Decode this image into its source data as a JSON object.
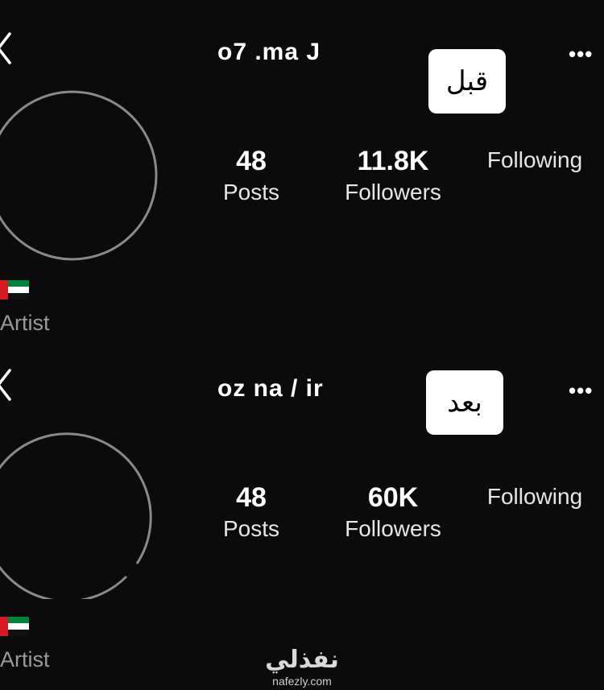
{
  "panels": [
    {
      "username": "o7 .ma J",
      "tag": "قبل",
      "stats": {
        "posts_count": "48",
        "posts_label": "Posts",
        "followers_count": "11.8K",
        "followers_label": "Followers",
        "following_label": "Following"
      },
      "bio": {
        "flag_icon": "uae-flag-icon",
        "category": "Artist"
      }
    },
    {
      "username": "oz na / ir",
      "tag": "بعد",
      "stats": {
        "posts_count": "48",
        "posts_label": "Posts",
        "followers_count": "60K",
        "followers_label": "Followers",
        "following_label": "Following"
      },
      "bio": {
        "flag_icon": "uae-flag-icon",
        "category": "Artist"
      }
    }
  ],
  "more_glyph": "•••",
  "watermark": {
    "logo_text": "نفذلي",
    "url": "nafezly.com"
  },
  "colors": {
    "background": "#0b0b0c",
    "text": "#f2f2f2",
    "secondary_text": "#9a9a9a",
    "tag_bg": "#ffffff"
  }
}
